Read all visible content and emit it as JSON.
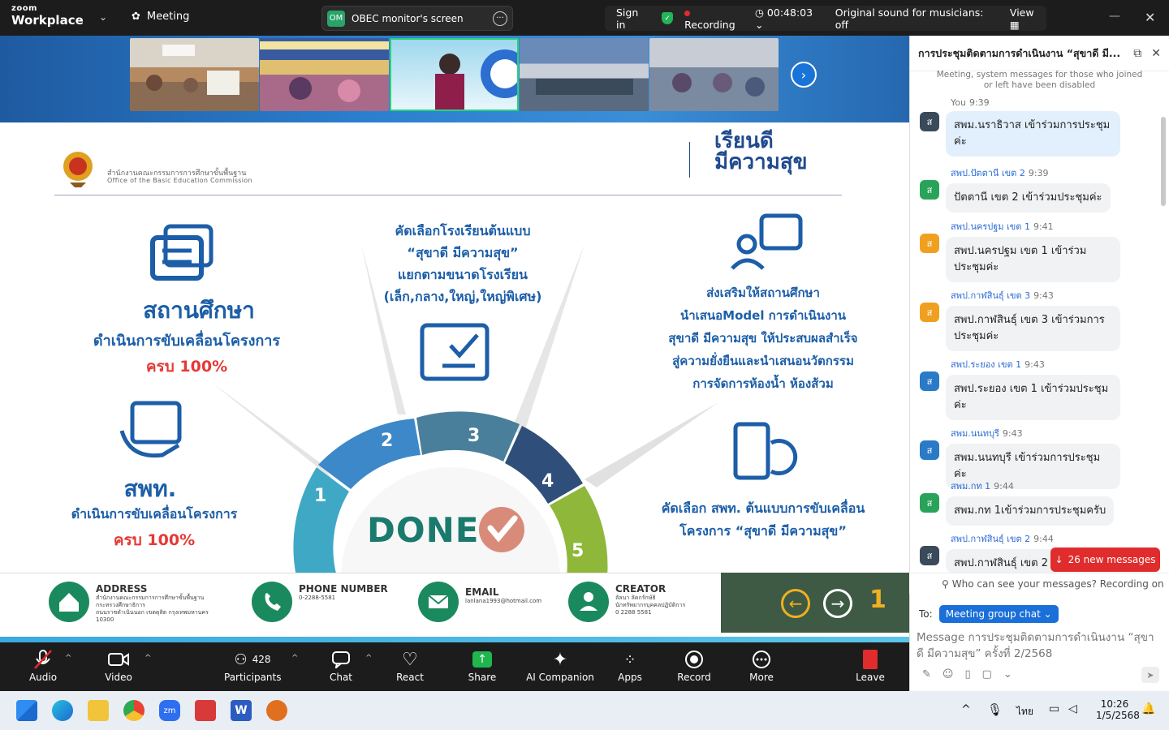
{
  "app": {
    "brand_top": "zoom",
    "brand_bottom": "Workplace",
    "meeting_tab": "Meeting"
  },
  "screen_share": {
    "avatar": "OM",
    "label": "OBEC monitor's screen"
  },
  "status": {
    "sign_in": "Sign in",
    "recording": "Recording",
    "timer": "00:48:03",
    "sound": "Original sound for musicians: off",
    "view": "View"
  },
  "slide": {
    "org_th": "สำนักงานคณะกรรมการการศึกษาขั้นพื้นฐาน",
    "org_en": "Office of the Basic Education Commission",
    "logo_l1": "เรียนดี",
    "logo_l2": "มีความสุข",
    "left1_title": "สถานศึกษา",
    "left1_sub": "ดำเนินการขับเคลื่อนโครงการ",
    "left1_pct": "ครบ 100%",
    "left2_title": "สพท.",
    "left2_sub": "ดำเนินการขับเคลื่อนโครงการ",
    "left2_pct": "ครบ 100%",
    "center_l1": "คัดเลือกโรงเรียนต้นแบบ",
    "center_l2": "“สุขาดี มีความสุข”",
    "center_l3": "แยกตามขนาดโรงเรียน",
    "center_l4": "(เล็ก,กลาง,ใหญ่,ใหญ่พิเศษ)",
    "right1_l1": "ส่งเสริมให้สถานศึกษา",
    "right1_l2": "นำเสนอModel การดำเนินงาน",
    "right1_l3": "สุขาดี มีความสุข ให้ประสบผลสำเร็จ",
    "right1_l4": "สู่ความยั่งยืนและนำเสนอนวัตกรรม",
    "right1_l5": "การจัดการห้องน้ำ ห้องส้วม",
    "right2_l1": "คัดเลือก สพท. ต้นแบบการขับเคลื่อน",
    "right2_l2": "โครงการ “สุขาดี มีความสุข”",
    "done": "DONE",
    "steps": [
      "1",
      "2",
      "3",
      "4",
      "5"
    ],
    "footer": {
      "address_title": "ADDRESS",
      "address_l1": "สำนักงานคณะกรรมการการศึกษาขั้นพื้นฐาน",
      "address_l2": "กระทรวงศึกษาธิการ",
      "address_l3": "ถนนราชดำเนินนอก เขตดุสิต กรุงเทพมหานคร",
      "address_l4": "10300",
      "phone_title": "PHONE NUMBER",
      "phone_val": "0-2288-5581",
      "email_title": "EMAIL",
      "email_val": "lanlana1993@hotmail.com",
      "creator_title": "CREATOR",
      "creator_l1": "ลัลนา ลัคกรักษ์ธิ",
      "creator_l2": "นักทรัพยากรบุคคลปฏิบัติการ",
      "creator_l3": "0 2288 5581",
      "page": "1"
    }
  },
  "toolbar": {
    "audio": "Audio",
    "video": "Video",
    "participants": "Participants",
    "participant_count": "428",
    "chat": "Chat",
    "react": "React",
    "share": "Share",
    "ai": "AI Companion",
    "apps": "Apps",
    "record": "Record",
    "more": "More",
    "leave": "Leave"
  },
  "chat": {
    "title": "การประชุมติดตามการดำเนินงาน “สุขาดี มี...",
    "sys1": "Meeting, system messages for those who joined",
    "sys2": "or left have been disabled",
    "messages": [
      {
        "sender": "You",
        "time": "9:39",
        "text": "สพม.นราธิวาส เข้าร่วมการประชุมค่ะ",
        "avatar": "ส"
      },
      {
        "sender": "สพป.ปัตตานี เขต 2",
        "time": "9:39",
        "text": "ปัตตานี เขต 2 เข้าร่วมประชุมค่ะ",
        "avatar": "ส"
      },
      {
        "sender": "สพป.นครปฐม เขต 1",
        "time": "9:41",
        "text": "สพป.นครปฐม เขต 1 เข้าร่วมประชุมค่ะ",
        "avatar": "ส"
      },
      {
        "sender": "สพป.กาฬสินธุ์ เขต 3",
        "time": "9:43",
        "text": "สพป.กาฬสินธุ์ เขต 3 เข้าร่วมการประชุมค่ะ",
        "avatar": "ส"
      },
      {
        "sender": "สพป.ระยอง เขต 1",
        "time": "9:43",
        "text": "สพป.ระยอง เขต 1 เข้าร่วมประชุมค่ะ",
        "avatar": "ส"
      },
      {
        "sender": "สพม.นนทบุรี",
        "time": "9:43",
        "text": "สพม.นนทบุรี เข้าร่วมการประชุมค่ะ",
        "avatar": "ส"
      },
      {
        "sender": "สพม.กท 1",
        "time": "9:44",
        "text": "สพม.กท 1เข้าร่วมการประชุมครับ",
        "avatar": "ส"
      },
      {
        "sender": "สพป.กาฬสินธุ์ เขต 2",
        "time": "9:44",
        "text": "สพป.กาฬสินธุ์ เขต 2",
        "avatar": "ส"
      }
    ],
    "new_messages": "26 new messages",
    "who_can_see": "Who can see your messages? Recording on",
    "to_label": "To:",
    "to_value": "Meeting group chat",
    "compose_placeholder": "Message การประชุมติดตามการดำเนินงาน “สุขาดี มีความสุข” ครั้งที่ 2/2568"
  },
  "taskbar": {
    "lang": "ไทย",
    "time": "10:26",
    "date": "1/5/2568"
  }
}
